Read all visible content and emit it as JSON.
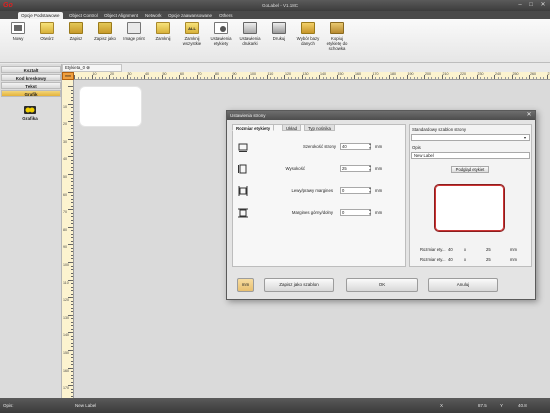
{
  "app": {
    "title": "GoLabel - V1.18C",
    "logo": "Go"
  },
  "menu_tabs": [
    "Opcje Podstawowe",
    "Object Control",
    "Object Alignment",
    "Network",
    "Opcje zaawansowane",
    "Others"
  ],
  "ribbon": [
    {
      "label": "Nowy",
      "icon": "new-document-icon"
    },
    {
      "label": "Otwórz",
      "icon": "open-folder-icon"
    },
    {
      "label": "Zapisz",
      "icon": "save-icon"
    },
    {
      "label": "Zapisz jako",
      "icon": "save-as-icon"
    },
    {
      "label": "Image print",
      "icon": "image-print-icon"
    },
    {
      "label": "Zamknij",
      "icon": "close-folder-icon"
    },
    {
      "label": "Zamknij wszystkie",
      "icon": "close-all-icon"
    },
    {
      "label": "Ustawienia etykiety",
      "icon": "label-settings-icon"
    },
    {
      "label": "Ustawienia drukarki",
      "icon": "printer-settings-icon"
    },
    {
      "label": "Drukuj",
      "icon": "print-icon"
    },
    {
      "label": "Wybór bazy danych",
      "icon": "database-icon"
    },
    {
      "label": "Kopiuj etykietę do schowka",
      "icon": "clipboard-icon"
    }
  ],
  "left_panel": [
    "Kształt",
    "Kod kreskowy",
    "Tekst",
    "Grafik"
  ],
  "left_panel_active": "Grafik",
  "grafika_label": "Grafika",
  "document_tab": "Etykieta_0",
  "ruler_top": [
    "10",
    "20",
    "30",
    "40",
    "50",
    "60",
    "70",
    "80",
    "90",
    "100",
    "110",
    "120",
    "130",
    "140",
    "150",
    "160",
    "170",
    "180",
    "190",
    "200",
    "210",
    "220",
    "230",
    "240",
    "250",
    "260",
    "270"
  ],
  "ruler_left": [
    "10",
    "20",
    "30",
    "40",
    "50",
    "60",
    "70",
    "80",
    "90",
    "100",
    "110",
    "120",
    "130",
    "140",
    "150",
    "160",
    "170",
    "180"
  ],
  "ruler_corner": "mm",
  "dialog": {
    "title": "Ustawienia strony",
    "tabs": [
      "Rozmiar etykiety",
      "Układ",
      "Typ nośnika"
    ],
    "rows": [
      {
        "label": "Szerokość strony",
        "value": "40",
        "unit": "mm",
        "icon": "width-icon"
      },
      {
        "label": "Wysokość",
        "value": "25",
        "unit": "mm",
        "icon": "height-icon"
      },
      {
        "label": "Lewy/prawy margines",
        "value": "0",
        "unit": "mm",
        "icon": "lr-margin-icon"
      },
      {
        "label": "Margines górny/dolny",
        "value": "0",
        "unit": "mm",
        "icon": "tb-margin-icon"
      }
    ],
    "template_label": "Standardowy szablon strony",
    "template_value": "",
    "desc_label": "Opis",
    "desc_value": "New Label",
    "preview_button": "Podgląd etykiet",
    "size_rows": [
      {
        "label": "Rozmiar ety...",
        "w": "40",
        "x": "x",
        "h": "25",
        "unit": "mm"
      },
      {
        "label": "Rozmiar ety...",
        "w": "40",
        "x": "x",
        "h": "25",
        "unit": "mm"
      }
    ],
    "buttons": {
      "unit": "mm",
      "save_template": "Zapisz jako szablon",
      "ok": "OK",
      "cancel": "Anuluj"
    }
  },
  "status": {
    "left": "Opis:",
    "name": "New Label",
    "x_label": "X",
    "x_value": "87.5",
    "y_label": "Y",
    "y_value": "40.8"
  }
}
